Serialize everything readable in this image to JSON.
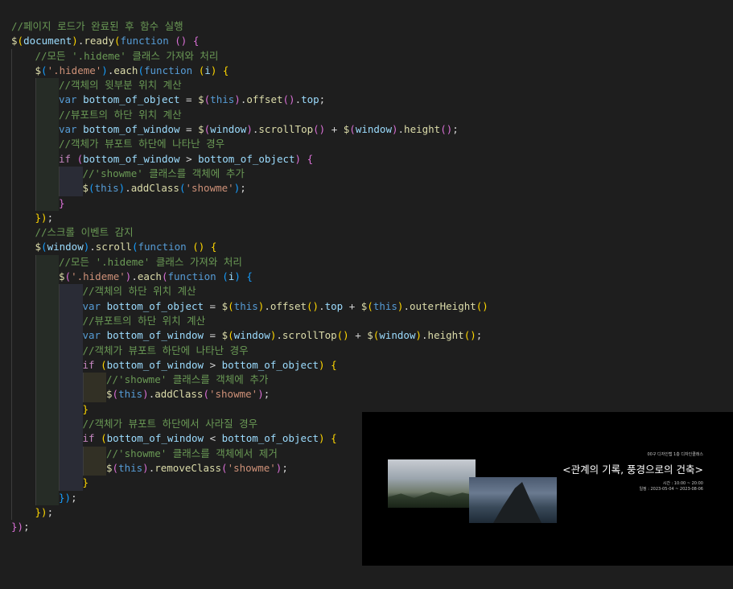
{
  "code_lines": [
    [
      {
        "c": "cm",
        "t": "//페이지 로드가 완료된 후 함수 실행"
      }
    ],
    [
      {
        "c": "fn",
        "t": "$"
      },
      {
        "c": "p1",
        "t": "("
      },
      {
        "c": "var",
        "t": "document"
      },
      {
        "c": "p1",
        "t": ")"
      },
      {
        "c": "op",
        "t": "."
      },
      {
        "c": "fn",
        "t": "ready"
      },
      {
        "c": "p1",
        "t": "("
      },
      {
        "c": "kw",
        "t": "function"
      },
      {
        "c": "op",
        "t": " "
      },
      {
        "c": "p2",
        "t": "()"
      },
      {
        "c": "op",
        "t": " "
      },
      {
        "c": "p2",
        "t": "{"
      }
    ],
    [
      {
        "c": "cm",
        "t": "//모든 '.hideme' 클래스 가져와 처리"
      }
    ],
    [
      {
        "c": "fn",
        "t": "$"
      },
      {
        "c": "p3",
        "t": "("
      },
      {
        "c": "str",
        "t": "'.hideme'"
      },
      {
        "c": "p3",
        "t": ")"
      },
      {
        "c": "op",
        "t": "."
      },
      {
        "c": "fn",
        "t": "each"
      },
      {
        "c": "p3",
        "t": "("
      },
      {
        "c": "kw",
        "t": "function"
      },
      {
        "c": "op",
        "t": " "
      },
      {
        "c": "p1",
        "t": "("
      },
      {
        "c": "var",
        "t": "i"
      },
      {
        "c": "p1",
        "t": ")"
      },
      {
        "c": "op",
        "t": " "
      },
      {
        "c": "p1",
        "t": "{"
      }
    ],
    [
      {
        "c": "cm",
        "t": "//객체의 윗부분 위치 계산"
      }
    ],
    [
      {
        "c": "kw",
        "t": "var"
      },
      {
        "c": "op",
        "t": " "
      },
      {
        "c": "var",
        "t": "bottom_of_object"
      },
      {
        "c": "op",
        "t": " = "
      },
      {
        "c": "fn",
        "t": "$"
      },
      {
        "c": "p2",
        "t": "("
      },
      {
        "c": "kw",
        "t": "this"
      },
      {
        "c": "p2",
        "t": ")"
      },
      {
        "c": "op",
        "t": "."
      },
      {
        "c": "fn",
        "t": "offset"
      },
      {
        "c": "p2",
        "t": "()"
      },
      {
        "c": "op",
        "t": "."
      },
      {
        "c": "var",
        "t": "top"
      },
      {
        "c": "op",
        "t": ";"
      }
    ],
    [
      {
        "c": "cm",
        "t": "//뷰포트의 하단 위치 계산"
      }
    ],
    [
      {
        "c": "kw",
        "t": "var"
      },
      {
        "c": "op",
        "t": " "
      },
      {
        "c": "var",
        "t": "bottom_of_window"
      },
      {
        "c": "op",
        "t": " = "
      },
      {
        "c": "fn",
        "t": "$"
      },
      {
        "c": "p2",
        "t": "("
      },
      {
        "c": "var",
        "t": "window"
      },
      {
        "c": "p2",
        "t": ")"
      },
      {
        "c": "op",
        "t": "."
      },
      {
        "c": "fn",
        "t": "scrollTop"
      },
      {
        "c": "p2",
        "t": "()"
      },
      {
        "c": "op",
        "t": " + "
      },
      {
        "c": "fn",
        "t": "$"
      },
      {
        "c": "p2",
        "t": "("
      },
      {
        "c": "var",
        "t": "window"
      },
      {
        "c": "p2",
        "t": ")"
      },
      {
        "c": "op",
        "t": "."
      },
      {
        "c": "fn",
        "t": "height"
      },
      {
        "c": "p2",
        "t": "()"
      },
      {
        "c": "op",
        "t": ";"
      }
    ],
    [
      {
        "c": "cm",
        "t": "//객체가 뷰포트 하단에 나타난 경우"
      }
    ],
    [
      {
        "c": "ctl",
        "t": "if"
      },
      {
        "c": "op",
        "t": " "
      },
      {
        "c": "p2",
        "t": "("
      },
      {
        "c": "var",
        "t": "bottom_of_window"
      },
      {
        "c": "op",
        "t": " > "
      },
      {
        "c": "var",
        "t": "bottom_of_object"
      },
      {
        "c": "p2",
        "t": ")"
      },
      {
        "c": "op",
        "t": " "
      },
      {
        "c": "p2",
        "t": "{"
      }
    ],
    [
      {
        "c": "cm",
        "t": "//'showme' 클래스를 객체에 추가"
      }
    ],
    [
      {
        "c": "fn",
        "t": "$"
      },
      {
        "c": "p3",
        "t": "("
      },
      {
        "c": "kw",
        "t": "this"
      },
      {
        "c": "p3",
        "t": ")"
      },
      {
        "c": "op",
        "t": "."
      },
      {
        "c": "fn",
        "t": "addClass"
      },
      {
        "c": "p3",
        "t": "("
      },
      {
        "c": "str",
        "t": "'showme'"
      },
      {
        "c": "p3",
        "t": ")"
      },
      {
        "c": "op",
        "t": ";"
      }
    ],
    [
      {
        "c": "p2",
        "t": "}"
      }
    ],
    [
      {
        "c": "p1",
        "t": "})"
      },
      {
        "c": "op",
        "t": ";"
      }
    ],
    [
      {
        "c": "cm",
        "t": "//스크롤 이벤트 감지"
      }
    ],
    [
      {
        "c": "fn",
        "t": "$"
      },
      {
        "c": "p3",
        "t": "("
      },
      {
        "c": "var",
        "t": "window"
      },
      {
        "c": "p3",
        "t": ")"
      },
      {
        "c": "op",
        "t": "."
      },
      {
        "c": "fn",
        "t": "scroll"
      },
      {
        "c": "p3",
        "t": "("
      },
      {
        "c": "kw",
        "t": "function"
      },
      {
        "c": "op",
        "t": " "
      },
      {
        "c": "p1",
        "t": "()"
      },
      {
        "c": "op",
        "t": " "
      },
      {
        "c": "p1",
        "t": "{"
      }
    ],
    [
      {
        "c": "cm",
        "t": "//모든 '.hideme' 클래스 가져와 처리"
      }
    ],
    [
      {
        "c": "fn",
        "t": "$"
      },
      {
        "c": "p2",
        "t": "("
      },
      {
        "c": "str",
        "t": "'.hideme'"
      },
      {
        "c": "p2",
        "t": ")"
      },
      {
        "c": "op",
        "t": "."
      },
      {
        "c": "fn",
        "t": "each"
      },
      {
        "c": "p2",
        "t": "("
      },
      {
        "c": "kw",
        "t": "function"
      },
      {
        "c": "op",
        "t": " "
      },
      {
        "c": "p3",
        "t": "("
      },
      {
        "c": "var",
        "t": "i"
      },
      {
        "c": "p3",
        "t": ")"
      },
      {
        "c": "op",
        "t": " "
      },
      {
        "c": "p3",
        "t": "{"
      }
    ],
    [
      {
        "c": "cm",
        "t": "//객체의 하단 위치 계산"
      }
    ],
    [
      {
        "c": "kw",
        "t": "var"
      },
      {
        "c": "op",
        "t": " "
      },
      {
        "c": "var",
        "t": "bottom_of_object"
      },
      {
        "c": "op",
        "t": " = "
      },
      {
        "c": "fn",
        "t": "$"
      },
      {
        "c": "p1",
        "t": "("
      },
      {
        "c": "kw",
        "t": "this"
      },
      {
        "c": "p1",
        "t": ")"
      },
      {
        "c": "op",
        "t": "."
      },
      {
        "c": "fn",
        "t": "offset"
      },
      {
        "c": "p1",
        "t": "()"
      },
      {
        "c": "op",
        "t": "."
      },
      {
        "c": "var",
        "t": "top"
      },
      {
        "c": "op",
        "t": " + "
      },
      {
        "c": "fn",
        "t": "$"
      },
      {
        "c": "p1",
        "t": "("
      },
      {
        "c": "kw",
        "t": "this"
      },
      {
        "c": "p1",
        "t": ")"
      },
      {
        "c": "op",
        "t": "."
      },
      {
        "c": "fn",
        "t": "outerHeight"
      },
      {
        "c": "p1",
        "t": "()"
      }
    ],
    [
      {
        "c": "cm",
        "t": "//뷰포트의 하단 위치 계산"
      }
    ],
    [
      {
        "c": "kw",
        "t": "var"
      },
      {
        "c": "op",
        "t": " "
      },
      {
        "c": "var",
        "t": "bottom_of_window"
      },
      {
        "c": "op",
        "t": " = "
      },
      {
        "c": "fn",
        "t": "$"
      },
      {
        "c": "p1",
        "t": "("
      },
      {
        "c": "var",
        "t": "window"
      },
      {
        "c": "p1",
        "t": ")"
      },
      {
        "c": "op",
        "t": "."
      },
      {
        "c": "fn",
        "t": "scrollTop"
      },
      {
        "c": "p1",
        "t": "()"
      },
      {
        "c": "op",
        "t": " + "
      },
      {
        "c": "fn",
        "t": "$"
      },
      {
        "c": "p1",
        "t": "("
      },
      {
        "c": "var",
        "t": "window"
      },
      {
        "c": "p1",
        "t": ")"
      },
      {
        "c": "op",
        "t": "."
      },
      {
        "c": "fn",
        "t": "height"
      },
      {
        "c": "p1",
        "t": "()"
      },
      {
        "c": "op",
        "t": ";"
      }
    ],
    [
      {
        "c": "cm",
        "t": "//객체가 뷰포트 하단에 나타난 경우"
      }
    ],
    [
      {
        "c": "ctl",
        "t": "if"
      },
      {
        "c": "op",
        "t": " "
      },
      {
        "c": "p1",
        "t": "("
      },
      {
        "c": "var",
        "t": "bottom_of_window"
      },
      {
        "c": "op",
        "t": " > "
      },
      {
        "c": "var",
        "t": "bottom_of_object"
      },
      {
        "c": "p1",
        "t": ")"
      },
      {
        "c": "op",
        "t": " "
      },
      {
        "c": "p1",
        "t": "{"
      }
    ],
    [
      {
        "c": "cm",
        "t": "//'showme' 클래스를 객체에 추가"
      }
    ],
    [
      {
        "c": "fn",
        "t": "$"
      },
      {
        "c": "p2",
        "t": "("
      },
      {
        "c": "kw",
        "t": "this"
      },
      {
        "c": "p2",
        "t": ")"
      },
      {
        "c": "op",
        "t": "."
      },
      {
        "c": "fn",
        "t": "addClass"
      },
      {
        "c": "p2",
        "t": "("
      },
      {
        "c": "str",
        "t": "'showme'"
      },
      {
        "c": "p2",
        "t": ")"
      },
      {
        "c": "op",
        "t": ";"
      }
    ],
    [
      {
        "c": "p1",
        "t": "}"
      }
    ],
    [
      {
        "c": "cm",
        "t": "//객체가 뷰포트 하단에서 사라질 경우"
      }
    ],
    [
      {
        "c": "ctl",
        "t": "if"
      },
      {
        "c": "op",
        "t": " "
      },
      {
        "c": "p1",
        "t": "("
      },
      {
        "c": "var",
        "t": "bottom_of_window"
      },
      {
        "c": "op",
        "t": " < "
      },
      {
        "c": "var",
        "t": "bottom_of_object"
      },
      {
        "c": "p1",
        "t": ")"
      },
      {
        "c": "op",
        "t": " "
      },
      {
        "c": "p1",
        "t": "{"
      }
    ],
    [
      {
        "c": "cm",
        "t": "//'showme' 클래스를 객체에서 제거"
      }
    ],
    [
      {
        "c": "fn",
        "t": "$"
      },
      {
        "c": "p2",
        "t": "("
      },
      {
        "c": "kw",
        "t": "this"
      },
      {
        "c": "p2",
        "t": ")"
      },
      {
        "c": "op",
        "t": "."
      },
      {
        "c": "fn",
        "t": "removeClass"
      },
      {
        "c": "p2",
        "t": "("
      },
      {
        "c": "str",
        "t": "'showme'"
      },
      {
        "c": "p2",
        "t": ")"
      },
      {
        "c": "op",
        "t": ";"
      }
    ],
    [
      {
        "c": "p1",
        "t": "}"
      }
    ],
    [
      {
        "c": "p3",
        "t": "})"
      },
      {
        "c": "op",
        "t": ";"
      }
    ],
    [
      {
        "c": "p1",
        "t": "})"
      },
      {
        "c": "op",
        "t": ";"
      }
    ],
    [
      {
        "c": "p2",
        "t": "})"
      },
      {
        "c": "op",
        "t": ";"
      }
    ]
  ],
  "preview": {
    "small_label": "00구 디자인랩 1층 디자인클래스",
    "title": "<관계의 기록, 풍경으로의 건축>",
    "hours": "시간 : 10:00 ~ 20:00",
    "period": "일정 : 2023-05-04 ~ 2023-08-06"
  },
  "colors": {
    "background": "#1e1e1e",
    "comment": "#6a9955",
    "function": "#dcdcaa",
    "keyword": "#569cd6",
    "control": "#c586c0",
    "string": "#ce9178",
    "variable": "#9cdcfe",
    "bracket1": "#ffd700",
    "bracket2": "#da70d6",
    "bracket3": "#179fff"
  }
}
